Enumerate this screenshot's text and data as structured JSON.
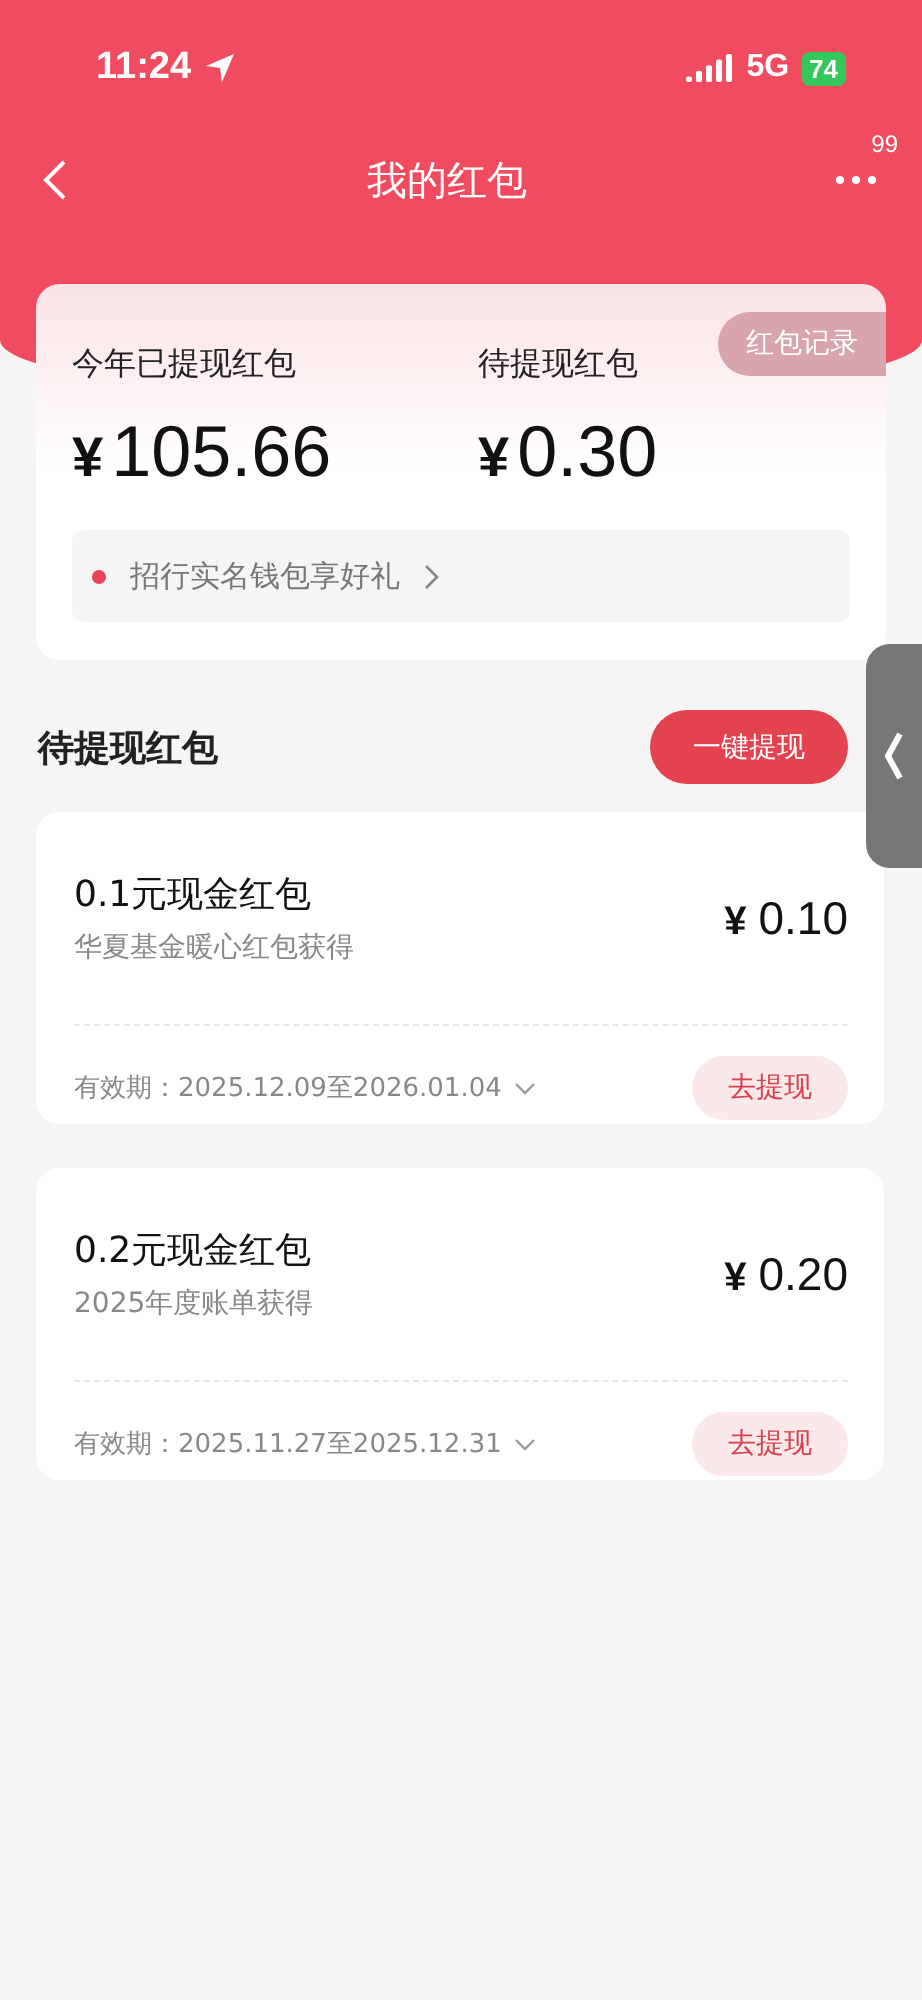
{
  "status_bar": {
    "time": "11:24",
    "network": "5G",
    "battery": "74"
  },
  "nav": {
    "title": "我的红包",
    "badge": "99"
  },
  "summary": {
    "records_button": "红包记录",
    "stats": [
      {
        "label": "今年已提现红包",
        "currency": "¥",
        "amount": "105.66"
      },
      {
        "label": "待提现红包",
        "currency": "¥",
        "amount": "0.30"
      }
    ],
    "promo": "招行实名钱包享好礼"
  },
  "section": {
    "title": "待提现红包",
    "button": "一键提现"
  },
  "packets": [
    {
      "title": "0.1元现金红包",
      "source": "华夏基金暖心红包获得",
      "currency": "¥",
      "amount": "0.10",
      "validity": "有效期：2025.12.09至2026.01.04",
      "action": "去提现"
    },
    {
      "title": "0.2元现金红包",
      "source": "2025年度账单获得",
      "currency": "¥",
      "amount": "0.20",
      "validity": "有效期：2025.11.27至2025.12.31",
      "action": "去提现"
    }
  ]
}
